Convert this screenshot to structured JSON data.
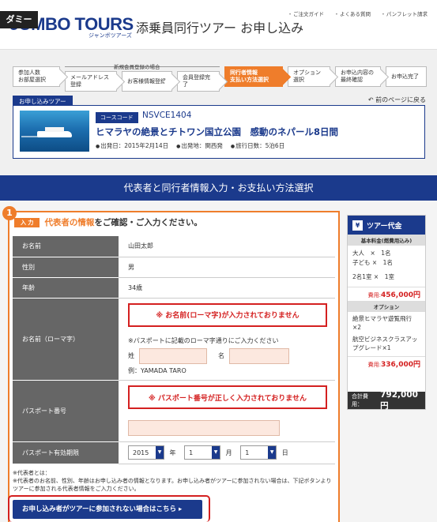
{
  "header": {
    "badge": "ダミー",
    "logo": "JUMBO TOURS",
    "logo_sub": "ジャンボツアーズ",
    "site_title": "添乗員同行ツアー お申し込み",
    "links": [
      "ご注文ガイド",
      "よくある質問",
      "パンフレット請求"
    ]
  },
  "steps": {
    "items": [
      "参加人数\nお部屋選択",
      "メールアドレス登録",
      "お客様情報登録",
      "会員登録完了",
      "同行者情報\n支払い方法選択",
      "オプション\n選択",
      "お申込内容の\n最終確認",
      "お申込完了"
    ],
    "new_member_note": "新規会員登録の場合"
  },
  "tour": {
    "section_label": "お申し込みツアー",
    "back_link": "前のページに戻る",
    "course_code_label": "コースコード",
    "course_code": "NSVCE1404",
    "title": "ヒマラヤの絶景とチトワン国立公園　感動のネパール8日間",
    "departure_date": "出発日：2015年2月14日",
    "departure_place": "出発地：関西発",
    "days": "旅行日数：5泊6日"
  },
  "section_title": "代表者と同行者情報入力・お支払い方法選択",
  "form": {
    "step_number": "1",
    "input_tag": "入 力",
    "heading_em": "代表者の情報",
    "heading_rest": "をご確認・ご入力ください。",
    "rows": {
      "name_label": "お名前",
      "name_value": "山田太郎",
      "gender_label": "性別",
      "gender_value": "男",
      "age_label": "年齢",
      "age_value": "34歳",
      "roman_label": "お名前（ローマ字）",
      "roman_error": "※ お名前(ローマ字)が入力されておりません",
      "roman_hint": "※パスポートに記載のローマ字通りにご入力ください",
      "surname_label": "姓",
      "given_label": "名",
      "roman_example": "例：YAMADA TARO",
      "passport_label": "パスポート番号",
      "passport_error": "※ パスポート番号が正しく入力されておりません",
      "expiry_label": "パスポート有効期限",
      "expiry_year": "2015",
      "expiry_year_unit": "年",
      "expiry_month": "1",
      "expiry_month_unit": "月",
      "expiry_day": "1",
      "expiry_day_unit": "日"
    },
    "note_1": "※代表者とは：",
    "note_2": "※代表者のお名前、性別、年齢はお申し込み者の情報となります。お申し込み者がツアーに参加されない場合は、下記ボタンよりツアーに参加される代表者情報をご入力ください。",
    "not_joining_button": "お申し込み者がツアーに参加されない場合はこちら ▸"
  },
  "price": {
    "title": "ツアー代金",
    "basic_label": "基本料金(燃費用込み)",
    "adult": "大人　×　1名",
    "child": "子ども ×　1名",
    "room": "2名1室 ×　1室",
    "basic_cost_label": "費用:",
    "basic_cost": "456,000円",
    "option_label": "オプション",
    "option_1": "絶景ヒマラヤ遊覧飛行×2",
    "option_2": "航空ビジネスクラスアップグレード×1",
    "option_cost_label": "費用:",
    "option_cost": "336,000円",
    "total_label": "合計費用：",
    "total": "792,000円"
  }
}
